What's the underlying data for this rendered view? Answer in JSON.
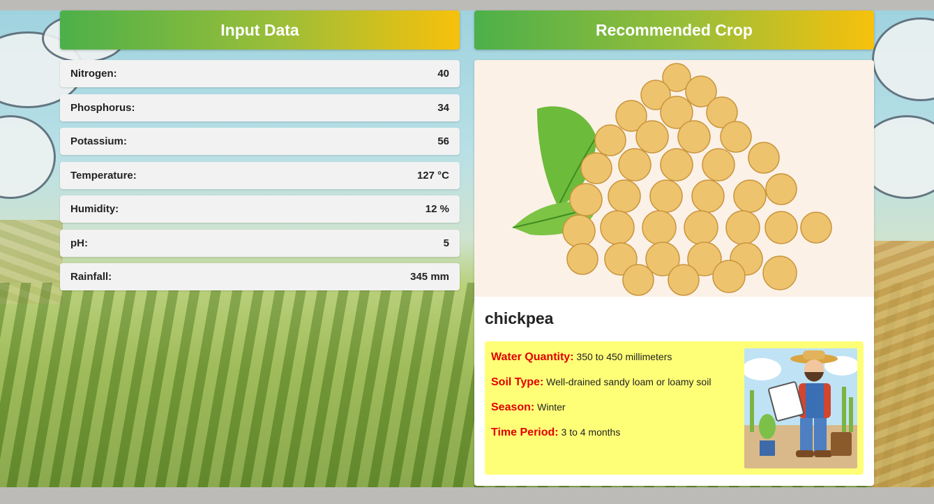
{
  "input": {
    "title": "Input Data",
    "rows": [
      {
        "label": "Nitrogen:",
        "value": "40"
      },
      {
        "label": "Phosphorus:",
        "value": "34"
      },
      {
        "label": "Potassium:",
        "value": "56"
      },
      {
        "label": "Temperature:",
        "value": "127 °C"
      },
      {
        "label": "Humidity:",
        "value": "12 %"
      },
      {
        "label": "pH:",
        "value": "5"
      },
      {
        "label": "Rainfall:",
        "value": "345 mm"
      }
    ]
  },
  "recommendation": {
    "title": "Recommended Crop",
    "crop_name": "chickpea",
    "details": [
      {
        "key": "Water Quantity:",
        "value": "350 to 450 millimeters"
      },
      {
        "key": "Soil Type:",
        "value": "Well-drained sandy loam or loamy soil"
      },
      {
        "key": "Season:",
        "value": "Winter"
      },
      {
        "key": "Time Period:",
        "value": "3 to 4 months"
      }
    ]
  },
  "colors": {
    "header_start": "#4cb04a",
    "header_end": "#f7c10c",
    "info_box": "#ffff77",
    "info_key": "#e00000"
  }
}
